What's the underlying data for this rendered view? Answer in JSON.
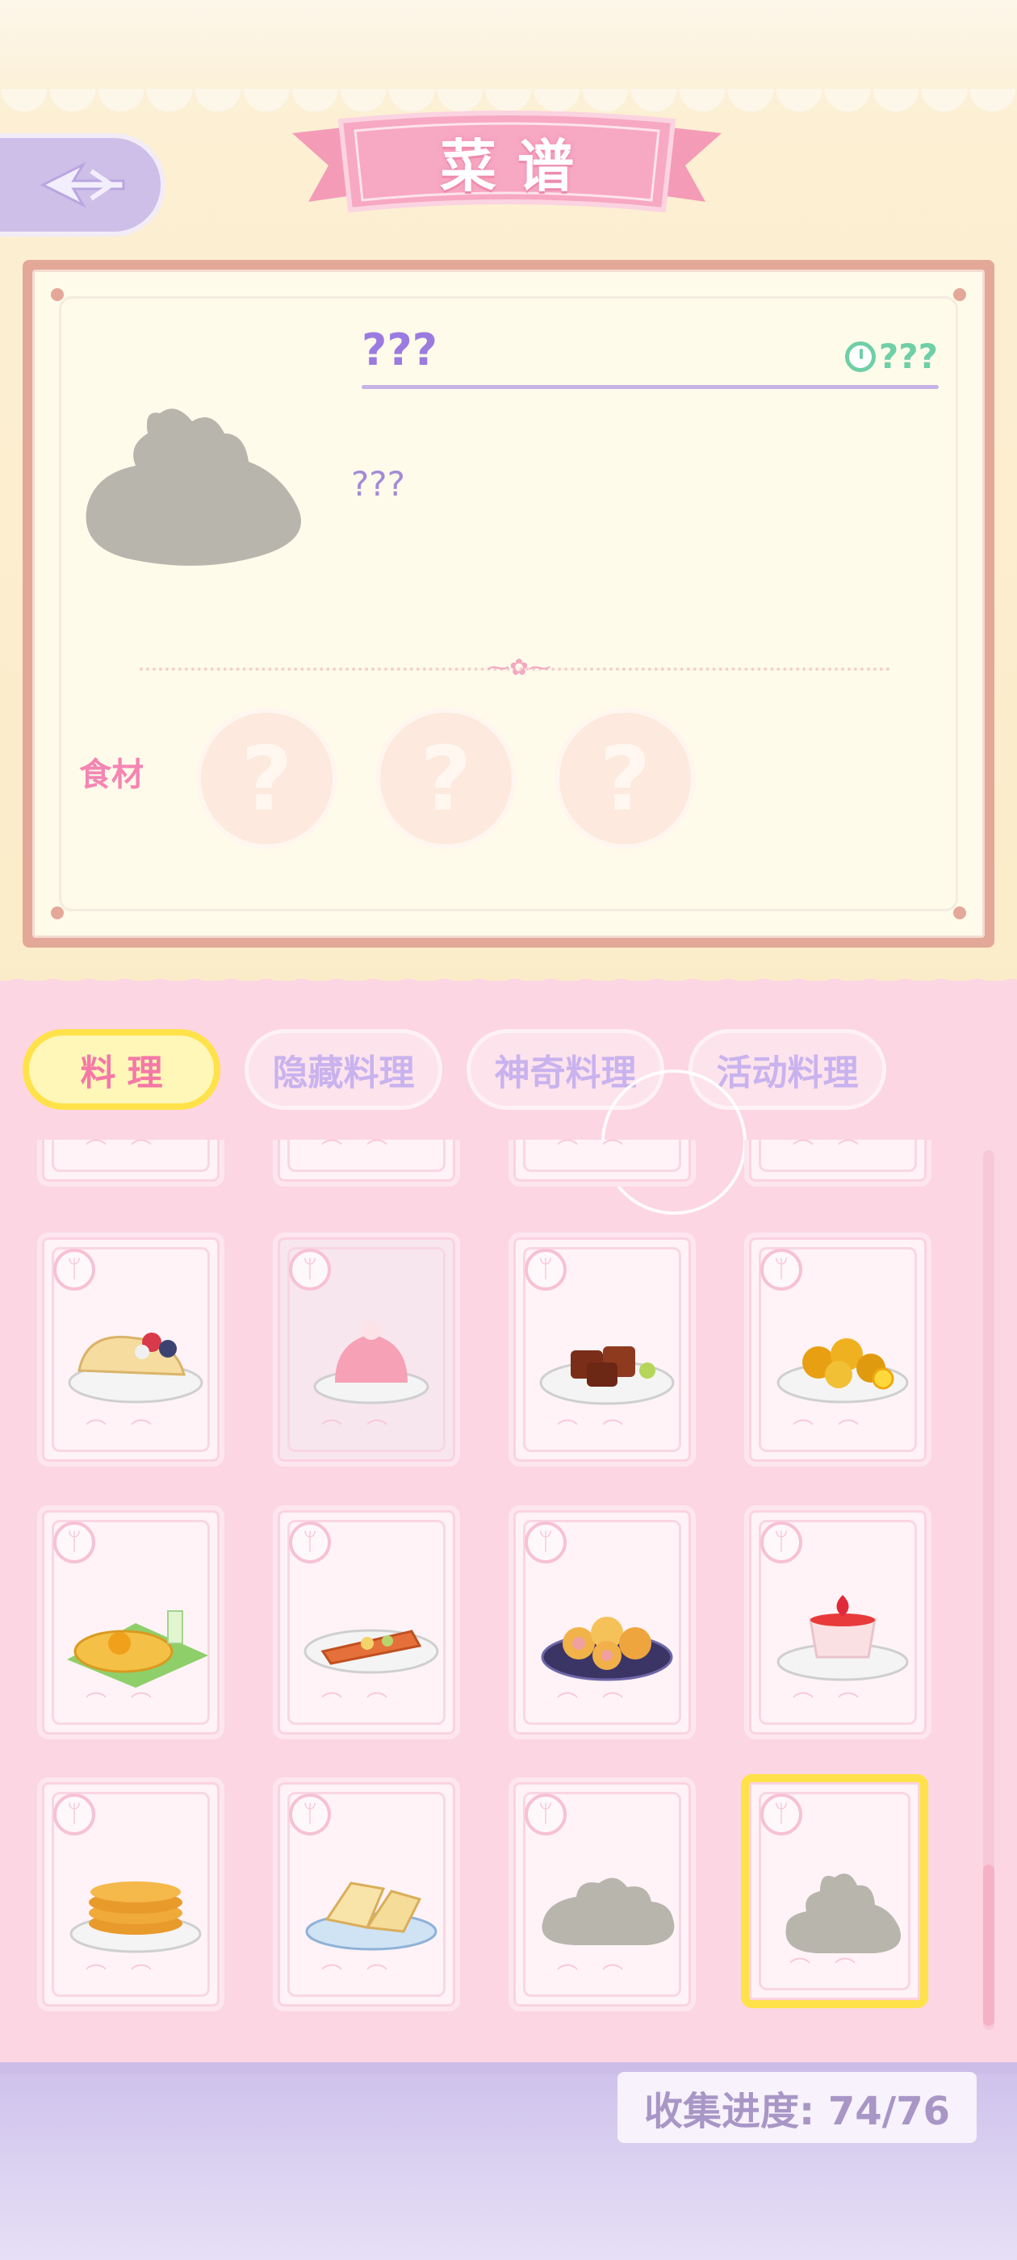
{
  "header": {
    "title": "菜谱"
  },
  "detail": {
    "dish_name": "???",
    "cook_time": "???",
    "description": "???",
    "ingredients_label": "食材",
    "ingredient_slots": [
      "?",
      "?",
      "?"
    ]
  },
  "tabs": [
    {
      "label": "料理",
      "active": true
    },
    {
      "label": "隐藏料理",
      "active": false
    },
    {
      "label": "神奇料理",
      "active": false
    },
    {
      "label": "活动料理",
      "active": false
    }
  ],
  "recipes": [
    {
      "dish": "taco",
      "unlocked": true
    },
    {
      "dish": "strawberry-jelly",
      "unlocked": true
    },
    {
      "dish": "braised-pork",
      "unlocked": true
    },
    {
      "dish": "lemon-chicken",
      "unlocked": true
    },
    {
      "dish": "fish-pancake-platter",
      "unlocked": true
    },
    {
      "dish": "grilled-fish",
      "unlocked": true
    },
    {
      "dish": "meat-rolls",
      "unlocked": true
    },
    {
      "dish": "strawberry-pudding",
      "unlocked": true
    },
    {
      "dish": "pancake-stack",
      "unlocked": true
    },
    {
      "dish": "toast-sandwich",
      "unlocked": true
    },
    {
      "dish": "unknown-dish",
      "unlocked": false
    },
    {
      "dish": "unknown-dish",
      "unlocked": false,
      "selected": true
    }
  ],
  "footer": {
    "progress_text": "收集进度: 74/76"
  },
  "colors": {
    "accent_pink": "#f585b3",
    "accent_purple": "#9b7be0",
    "highlight_yellow": "#ffe24a"
  }
}
